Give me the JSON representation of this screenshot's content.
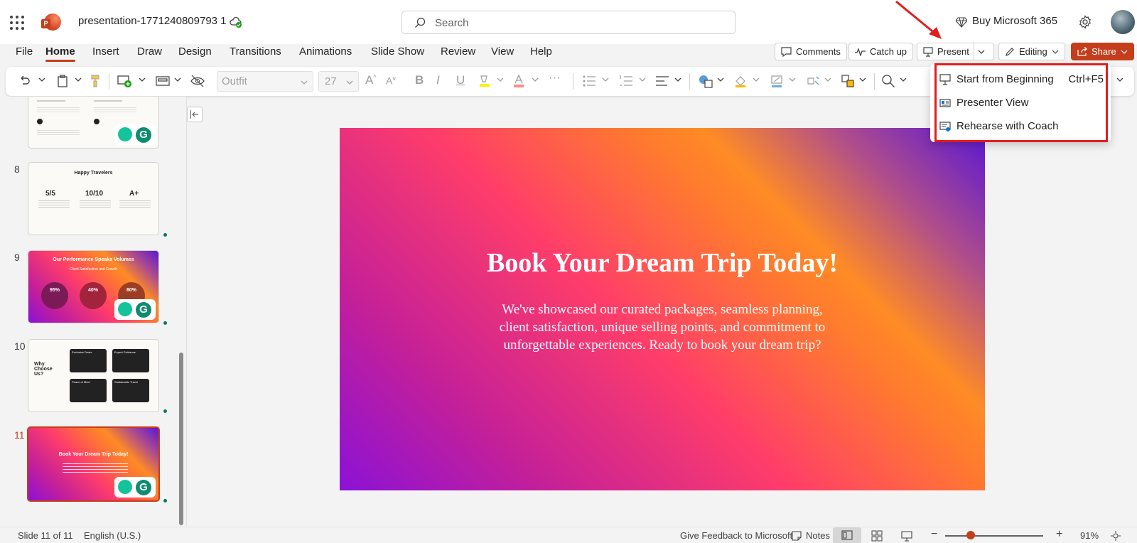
{
  "app": {
    "document_title": "presentation-1771240809793 1",
    "search_placeholder": "Search",
    "buy_label": "Buy Microsoft 365"
  },
  "menu_tabs": [
    "File",
    "Home",
    "Insert",
    "Draw",
    "Design",
    "Transitions",
    "Animations",
    "Slide Show",
    "Review",
    "View",
    "Help"
  ],
  "active_tab": "Home",
  "header_buttons": {
    "comments": "Comments",
    "catch_up": "Catch up",
    "present": "Present",
    "editing": "Editing",
    "share": "Share"
  },
  "ribbon": {
    "font_name": "Outfit",
    "font_size": "27"
  },
  "present_menu": [
    {
      "label": "Start from Beginning",
      "shortcut": "Ctrl+F5",
      "icon": "present-icon"
    },
    {
      "label": "Presenter View",
      "shortcut": "",
      "icon": "presenter-view-icon"
    },
    {
      "label": "Rehearse with Coach",
      "shortcut": "",
      "icon": "rehearse-icon"
    }
  ],
  "thumbnails": [
    {
      "number": "8",
      "title": "Happy Travelers",
      "stats": [
        "5/5",
        "10/10",
        "A+"
      ]
    },
    {
      "number": "9",
      "title": "Our Performance Speaks Volumes",
      "subtitle": "Client Satisfaction and Growth",
      "stats": [
        "95%",
        "40%",
        "80%"
      ]
    },
    {
      "number": "10",
      "title": "Why Choose Us?",
      "cards": [
        "Exclusive Deals",
        "Expert Guidance",
        "Peace of Mind",
        "Sustainable Travel"
      ]
    },
    {
      "number": "11",
      "title": "Book Your Dream Trip Today!"
    }
  ],
  "slide": {
    "title": "Book Your Dream Trip Today!",
    "body": "We've showcased our curated packages, seamless planning, client satisfaction, unique selling points, and commitment to unforgettable experiences. Ready to book your dream trip?"
  },
  "status_bar": {
    "slide_info": "Slide 11 of 11",
    "language": "English (U.S.)",
    "feedback": "Give Feedback to Microsoft",
    "notes": "Notes",
    "zoom": "91%",
    "zoom_fraction": 0.26
  },
  "colors": {
    "accent": "#c43e1c",
    "annotation_red": "#e01e1e"
  }
}
